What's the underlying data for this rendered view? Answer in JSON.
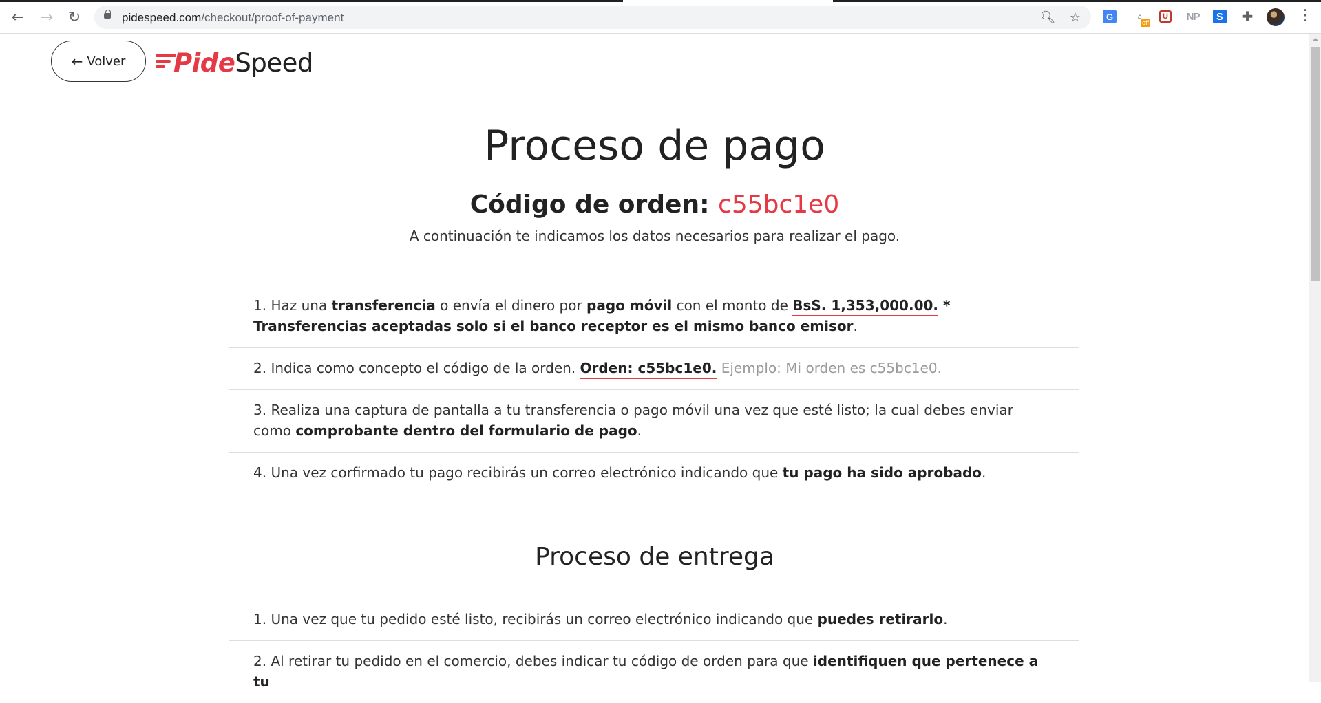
{
  "browser": {
    "url_host": "pidespeed.com",
    "url_path": "/checkout/proof-of-payment",
    "extensions": {
      "translate": "G",
      "off_badge": "off",
      "pocket": "U",
      "np": "NP",
      "s": "S"
    }
  },
  "header": {
    "back_label": "Volver",
    "logo_part1": "Pide",
    "logo_part2": "Speed"
  },
  "payment": {
    "title": "Proceso de pago",
    "order_label": "Código de orden:",
    "order_code": "c55bc1e0",
    "intro": "A continuación te indicamos los datos necesarios para realizar el pago.",
    "step1": {
      "t1": "1. Haz una ",
      "b1": "transferencia",
      "t2": " o envía el dinero por ",
      "b2": "pago móvil",
      "t3": " con el monto de ",
      "amount": "BsS. 1,353,000.00.",
      "b3": " * Transferencias aceptadas solo si el banco receptor es el mismo banco emisor",
      "t4": "."
    },
    "step2": {
      "t1": "2. Indica como concepto el código de la orden. ",
      "concept": "Orden: c55bc1e0.",
      "example": " Ejemplo: Mi orden es c55bc1e0."
    },
    "step3": {
      "t1": "3. Realiza una captura de pantalla a tu transferencia o pago móvil una vez que esté listo; la cual debes enviar como ",
      "b1": "comprobante dentro del formulario de pago",
      "t2": "."
    },
    "step4": {
      "t1": "4. Una vez corfirmado tu pago recibirás un correo electrónico indicando que ",
      "b1": "tu pago ha sido aprobado",
      "t2": "."
    }
  },
  "delivery": {
    "title": "Proceso de entrega",
    "step1": {
      "t1": "1. Una vez que tu pedido esté listo, recibirás un correo electrónico indicando que ",
      "b1": "puedes retirarlo",
      "t2": "."
    },
    "step2": {
      "t1": "2. Al retirar tu pedido en el comercio, debes indicar tu código de orden para que ",
      "b1": "identifiquen que pertenece a tu"
    }
  },
  "colors": {
    "accent": "#e63946",
    "text": "#222222",
    "muted": "#9a9a9a"
  }
}
